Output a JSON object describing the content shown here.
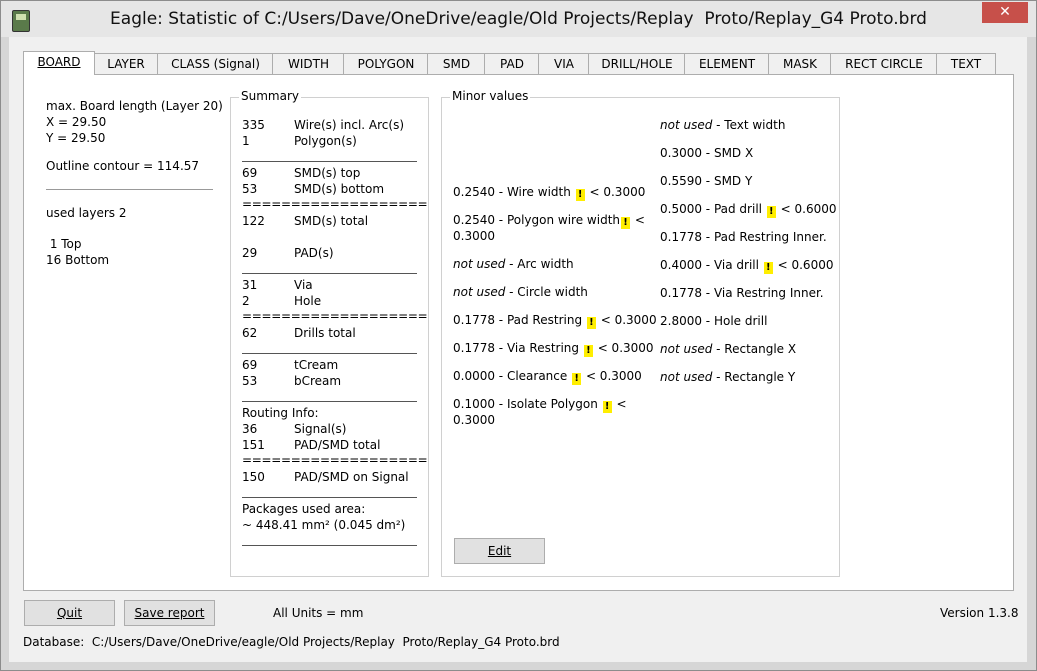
{
  "window": {
    "title": "Eagle: Statistic of C:/Users/Dave/OneDrive/eagle/Old Projects/Replay  Proto/Replay_G4 Proto.brd",
    "close_label": "✕"
  },
  "tabs": [
    "BOARD",
    "LAYER",
    "CLASS (Signal)",
    "WIDTH",
    "POLYGON",
    "SMD",
    "PAD",
    "VIA",
    "DRILL/HOLE",
    "ELEMENT",
    "MASK",
    "RECT CIRCLE",
    "TEXT"
  ],
  "board": {
    "max_length": "max. Board length (Layer 20)",
    "x": "X = 29.50",
    "y": "Y = 29.50",
    "outline": "Outline contour = 114.57",
    "used_layers": "used layers 2",
    "layer1": " 1 Top",
    "layer2": "16 Bottom"
  },
  "summary": {
    "title": "Summary",
    "rows": [
      {
        "n": "335",
        "label": "Wire(s) incl. Arc(s)"
      },
      {
        "n": "1",
        "label": "Polygon(s)"
      },
      {
        "n": "69",
        "label": "SMD(s) top"
      },
      {
        "n": "53",
        "label": "SMD(s) bottom"
      },
      {
        "n": "122",
        "label": "SMD(s) total"
      },
      {
        "n": "29",
        "label": "PAD(s)"
      },
      {
        "n": "31",
        "label": "Via"
      },
      {
        "n": "2",
        "label": "Hole"
      },
      {
        "n": "62",
        "label": "Drills total"
      },
      {
        "n": "69",
        "label": "tCream"
      },
      {
        "n": "53",
        "label": "bCream"
      },
      {
        "n": "36",
        "label": "Signal(s)"
      },
      {
        "n": "151",
        "label": "PAD/SMD total"
      },
      {
        "n": "150",
        "label": "PAD/SMD on Signal"
      }
    ],
    "eq_line": "===================",
    "routing_info": "Routing Info:",
    "packages_area": "Packages used area:",
    "packages_value": "~ 448.41 mm² (0.045 dm²)"
  },
  "minor": {
    "title": "Minor values",
    "warn_glyph": "!",
    "not_used": "not used",
    "left": {
      "wire_width_val": "0.2540 - Wire width",
      "wire_width_lim": "< 0.3000",
      "poly_width_val": "0.2540 - Polygon wire width",
      "poly_width_lim": "<",
      "poly_width_lim2": "0.3000",
      "arc_width": " - Arc width",
      "circle_width": " - Circle width",
      "pad_restring_val": "0.1778 - Pad Restring",
      "pad_restring_lim": "< 0.3000",
      "via_restring_val": "0.1778 - Via Restring",
      "via_restring_lim": "< 0.3000",
      "clearance_val": "0.0000 - Clearance",
      "clearance_lim": "< 0.3000",
      "isolate_val": "0.1000 - Isolate Polygon",
      "isolate_lim": "<",
      "isolate_lim2": "0.3000"
    },
    "right": {
      "text_width": " - Text width",
      "smd_x": "0.3000 - SMD X",
      "smd_y": "0.5590 - SMD Y",
      "pad_drill_val": "0.5000 - Pad drill",
      "pad_drill_lim": "< 0.6000",
      "pad_restring_inner": "0.1778 - Pad Restring Inner.",
      "via_drill_val": "0.4000 - Via drill",
      "via_drill_lim": "< 0.6000",
      "via_restring_inner": "0.1778 - Via Restring Inner.",
      "hole_drill": "2.8000 - Hole drill",
      "rect_x": " - Rectangle X",
      "rect_y": " - Rectangle Y"
    },
    "edit_label": "Edit"
  },
  "footer": {
    "quit_label": "Quit",
    "save_label": "Save report",
    "units": "All Units = mm",
    "version": "Version 1.3.8",
    "database": "Database:  C:/Users/Dave/OneDrive/eagle/Old Projects/Replay  Proto/Replay_G4 Proto.brd"
  }
}
